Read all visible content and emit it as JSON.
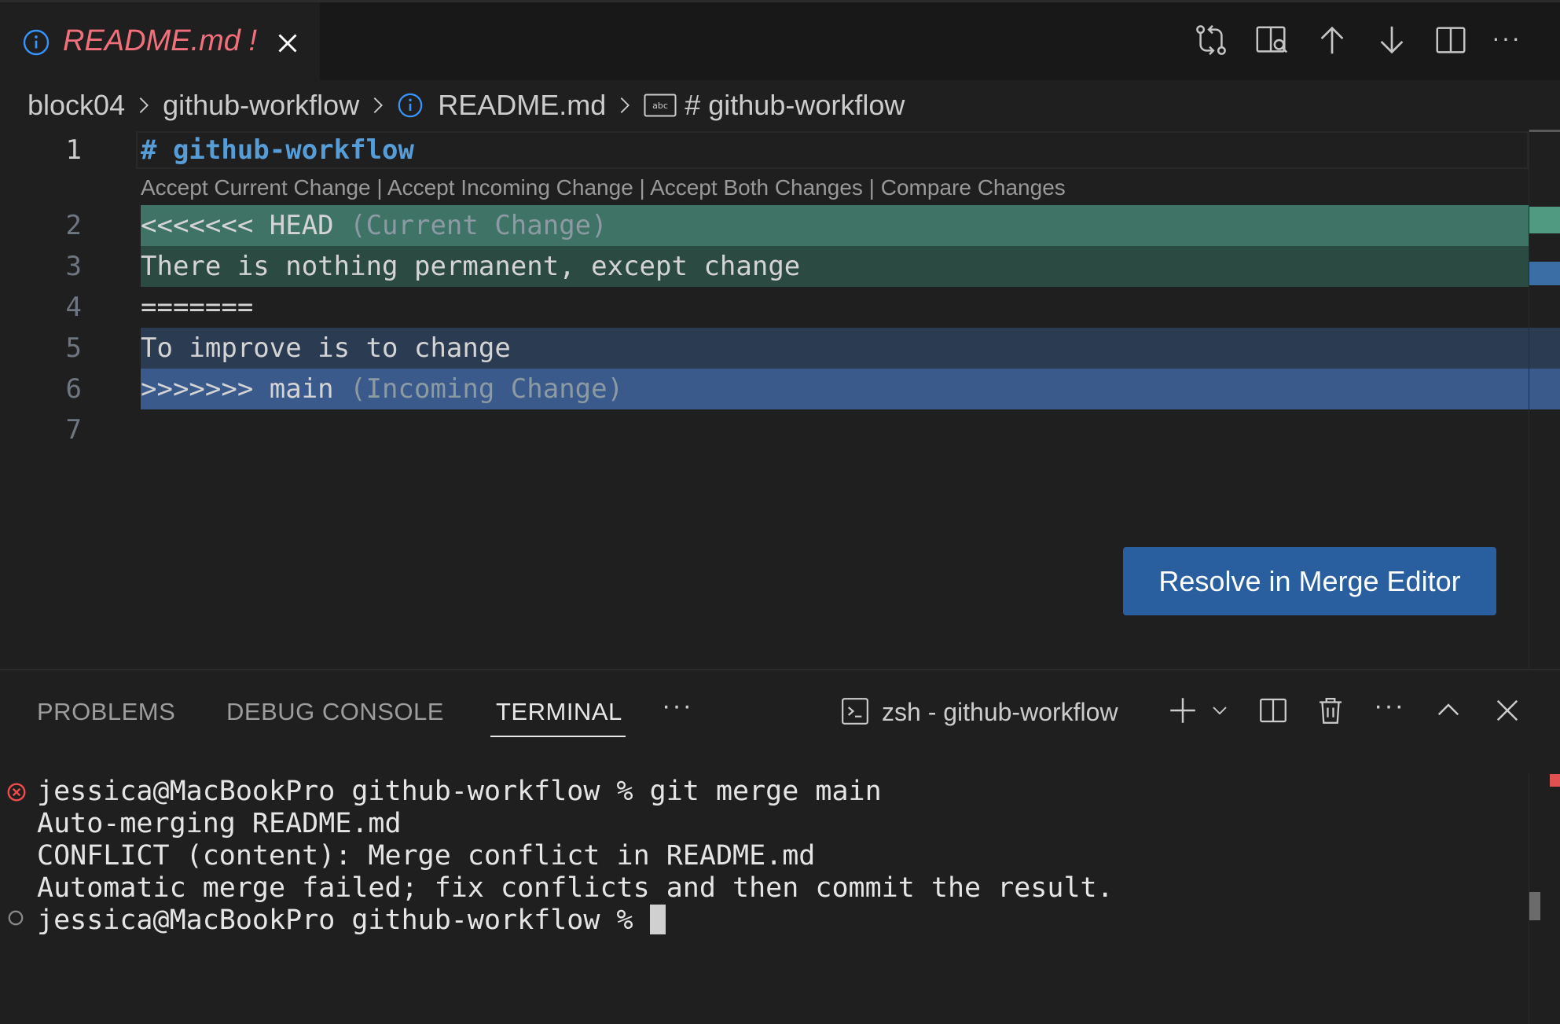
{
  "tab": {
    "filename": "README.md",
    "status": "!"
  },
  "toolbar": {
    "icons": [
      "git-compare-icon",
      "open-preview-icon",
      "previous-change-icon",
      "next-change-icon",
      "split-editor-icon",
      "more-actions-icon"
    ],
    "more": "···"
  },
  "breadcrumb": [
    "block04",
    "github-workflow",
    "README.md",
    "# github-workflow"
  ],
  "editor": {
    "line_numbers": [
      "1",
      "2",
      "3",
      "4",
      "5",
      "6",
      "7"
    ],
    "heading": "# github-workflow",
    "codelens": [
      "Accept Current Change",
      "Accept Incoming Change",
      "Accept Both Changes",
      "Compare Changes"
    ],
    "codelens_sep": " | ",
    "current_marker": "<<<<<<< HEAD",
    "current_label": " (Current Change)",
    "current_text": "There is nothing permanent, except change",
    "divider": "=======",
    "incoming_text": "To improve is to change",
    "incoming_marker": ">>>>>>> main",
    "incoming_label": " (Incoming Change)"
  },
  "merge_button": "Resolve in Merge Editor",
  "panel": {
    "tabs": [
      "PROBLEMS",
      "DEBUG CONSOLE",
      "TERMINAL"
    ],
    "active_tab": "TERMINAL",
    "more": "···",
    "terminal_name": "zsh - github-workflow"
  },
  "terminal": {
    "lines": [
      "jessica@MacBookPro github-workflow % git merge main",
      "Auto-merging README.md",
      "CONFLICT (content): Merge conflict in README.md",
      "Automatic merge failed; fix conflicts and then commit the result."
    ],
    "prompt": "jessica@MacBookPro github-workflow % "
  },
  "colors": {
    "current_header": "#3f7366",
    "current_body": "#2b4a41",
    "incoming_body": "#2b3b52",
    "incoming_header": "#3a5a8b",
    "tab_modified": "#f1707b",
    "button": "#2a5f9f"
  }
}
